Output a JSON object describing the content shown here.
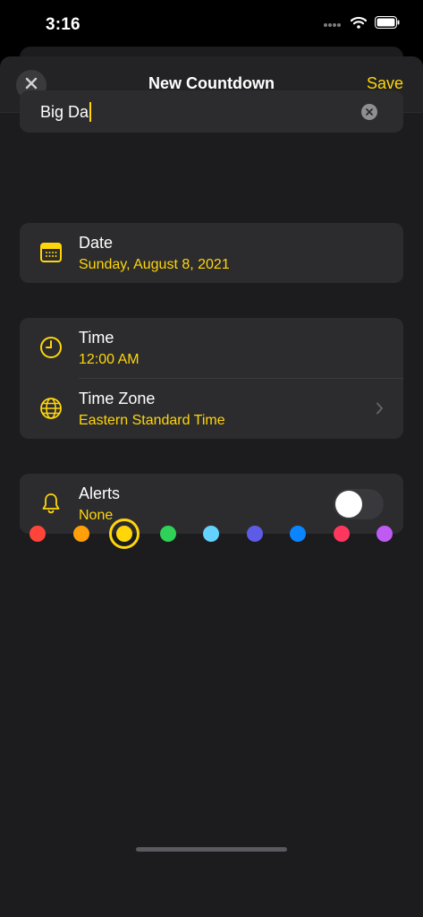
{
  "status": {
    "time": "3:16"
  },
  "nav": {
    "title": "New Countdown",
    "save_label": "Save"
  },
  "name_field": {
    "value": "Big Da"
  },
  "date": {
    "title": "Date",
    "value": "Sunday, August 8, 2021"
  },
  "time": {
    "title": "Time",
    "value": "12:00 AM"
  },
  "timezone": {
    "title": "Time Zone",
    "value": "Eastern Standard Time"
  },
  "alerts": {
    "title": "Alerts",
    "value": "None",
    "enabled": false
  },
  "accent_color": "#ffd60a",
  "colors": [
    "#ff453a",
    "#ff9f0a",
    "#ffd60a",
    "#30d158",
    "#64d2ff",
    "#5e5ce6",
    "#0a84ff",
    "#ff375f",
    "#bf5af2"
  ],
  "selected_color_index": 2
}
